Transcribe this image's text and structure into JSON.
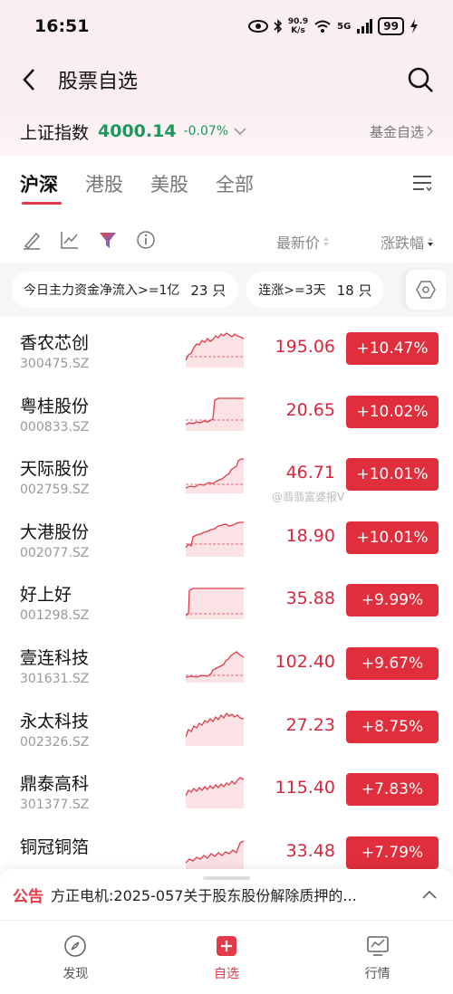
{
  "status": {
    "time": "16:51",
    "net_speed_value": "90.9",
    "net_speed_unit": "K/s",
    "network": "5G",
    "battery": "99"
  },
  "header": {
    "title": "股票自选"
  },
  "index": {
    "name": "上证指数",
    "value": "4000.14",
    "change": "-0.07%",
    "fund_link": "基金自选"
  },
  "tabs": [
    "沪深",
    "港股",
    "美股",
    "全部"
  ],
  "columns": {
    "price": "最新价",
    "change": "涨跌幅"
  },
  "filters": [
    {
      "label": "今日主力资金净流入>=1亿",
      "count": "23 只"
    },
    {
      "label": "连涨>=3天",
      "count": "18 只"
    }
  ],
  "watermark": "@翡翡富婆报V",
  "stocks": [
    {
      "name": "香农芯创",
      "code": "300475.SZ",
      "price": "195.06",
      "change": "+10.47%"
    },
    {
      "name": "粤桂股份",
      "code": "000833.SZ",
      "price": "20.65",
      "change": "+10.02%"
    },
    {
      "name": "天际股份",
      "code": "002759.SZ",
      "price": "46.71",
      "change": "+10.01%"
    },
    {
      "name": "大港股份",
      "code": "002077.SZ",
      "price": "18.90",
      "change": "+10.01%"
    },
    {
      "name": "好上好",
      "code": "001298.SZ",
      "price": "35.88",
      "change": "+9.99%"
    },
    {
      "name": "壹连科技",
      "code": "301631.SZ",
      "price": "102.40",
      "change": "+9.67%"
    },
    {
      "name": "永太科技",
      "code": "002326.SZ",
      "price": "27.23",
      "change": "+8.75%"
    },
    {
      "name": "鼎泰高科",
      "code": "301377.SZ",
      "price": "115.40",
      "change": "+7.83%"
    },
    {
      "name": "铜冠铜箔",
      "code": "",
      "price": "33.48",
      "change": "+7.79%"
    }
  ],
  "notice": {
    "tag": "公告",
    "text": "方正电机:2025-057关于股东股份解除质押的..."
  },
  "nav": [
    {
      "label": "发现",
      "icon": "compass-icon"
    },
    {
      "label": "自选",
      "icon": "plus-square-icon"
    },
    {
      "label": "行情",
      "icon": "monitor-chart-icon"
    }
  ],
  "colors": {
    "up": "#e02e3c",
    "down": "#1a9a5a",
    "accent": "#e23a48"
  }
}
